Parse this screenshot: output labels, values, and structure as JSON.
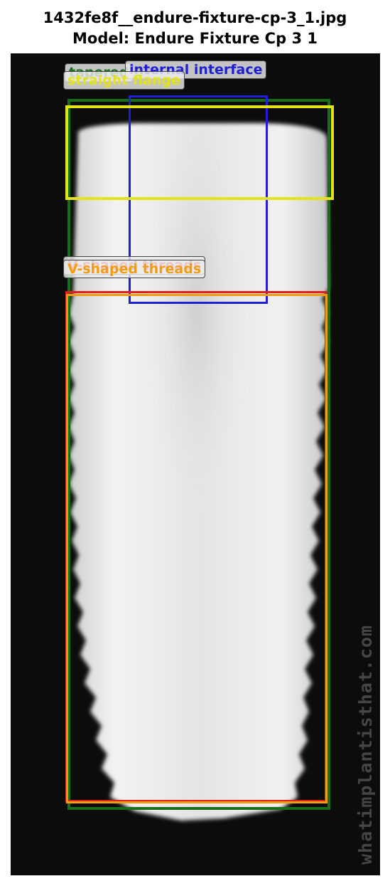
{
  "header": {
    "filename": "1432fe8f__endure-fixture-cp-3_1.jpg",
    "model": "Model: Endure Fixture Cp 3 1"
  },
  "annotations": [
    {
      "label": "tapered",
      "color": "#1a6e1a"
    },
    {
      "label": "internal interface",
      "color": "#1f1fd6"
    },
    {
      "label": "straight flange",
      "color": "#e3e31c"
    },
    {
      "label": "V-shaped threads",
      "color": "#e02020"
    },
    {
      "label": "V-shaped threads",
      "color": "#f39c12"
    }
  ],
  "watermark": "whatimplantisthat.com"
}
